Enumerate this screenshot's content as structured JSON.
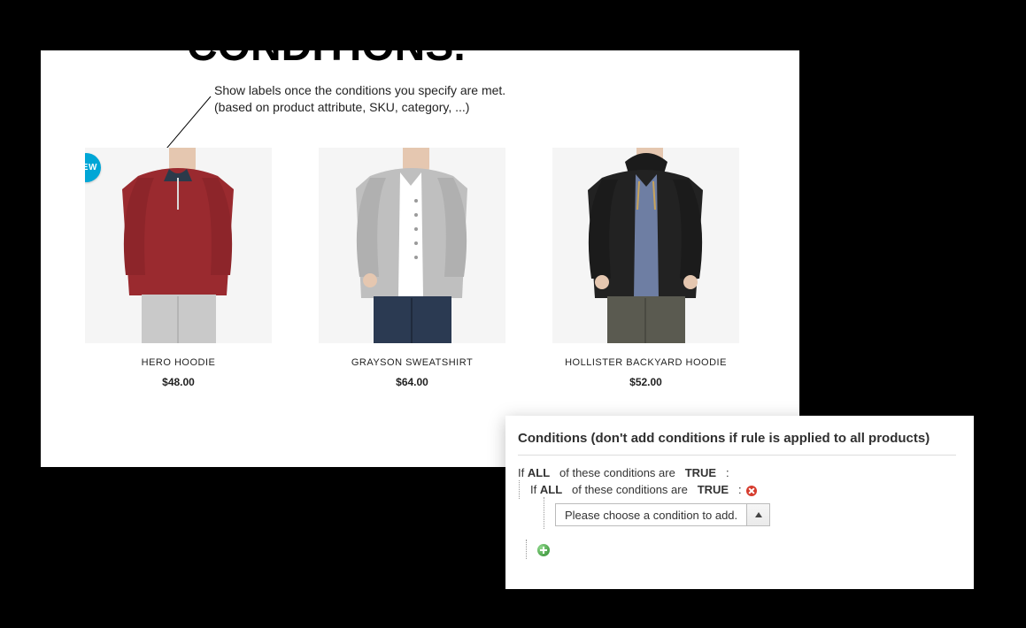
{
  "headline": "CONDITIONS.",
  "subhead_line1": "Show labels once the conditions you specify are met.",
  "subhead_line2": "(based on product attribute, SKU, category, ...)",
  "badge_new": "NEW",
  "products": [
    {
      "name": "HERO HOODIE",
      "price": "$48.00"
    },
    {
      "name": "GRAYSON SWEATSHIRT",
      "price": "$64.00"
    },
    {
      "name": "HOLLISTER BACKYARD HOODIE",
      "price": "$52.00"
    }
  ],
  "panel": {
    "title": "Conditions (don't add conditions if rule is applied to all products)",
    "if_label": "If",
    "all_label": "ALL",
    "of_these": "of these conditions are",
    "true_label": "TRUE",
    "colon": ":",
    "select_placeholder": "Please choose a condition to add."
  }
}
